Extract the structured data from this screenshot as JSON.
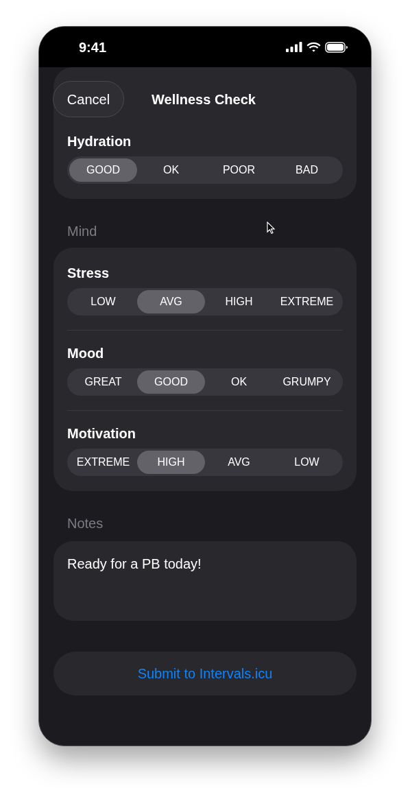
{
  "status_bar": {
    "time": "9:41"
  },
  "header": {
    "cancel": "Cancel",
    "title": "Wellness Check"
  },
  "sections": [
    {
      "items": [
        {
          "label": "Hydration",
          "options": [
            {
              "label": "GOOD",
              "selected": true
            },
            {
              "label": "OK",
              "selected": false
            },
            {
              "label": "POOR",
              "selected": false
            },
            {
              "label": "BAD",
              "selected": false
            }
          ]
        }
      ]
    },
    {
      "heading": "Mind",
      "items": [
        {
          "label": "Stress",
          "options": [
            {
              "label": "LOW",
              "selected": false
            },
            {
              "label": "AVG",
              "selected": true
            },
            {
              "label": "HIGH",
              "selected": false
            },
            {
              "label": "EXTREME",
              "selected": false
            }
          ]
        },
        {
          "label": "Mood",
          "options": [
            {
              "label": "GREAT",
              "selected": false
            },
            {
              "label": "GOOD",
              "selected": true
            },
            {
              "label": "OK",
              "selected": false
            },
            {
              "label": "GRUMPY",
              "selected": false
            }
          ]
        },
        {
          "label": "Motivation",
          "options": [
            {
              "label": "EXTREME",
              "selected": false
            },
            {
              "label": "HIGH",
              "selected": true
            },
            {
              "label": "AVG",
              "selected": false
            },
            {
              "label": "LOW",
              "selected": false
            }
          ]
        }
      ]
    }
  ],
  "notes": {
    "heading": "Notes",
    "value": "Ready for a PB today!"
  },
  "submit_button": "Submit to Intervals.icu"
}
